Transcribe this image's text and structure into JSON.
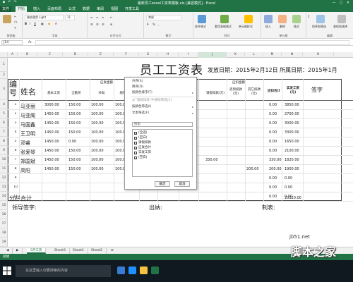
{
  "window": {
    "title": "最新员工excel工资表模板.xls [兼容模式] - Excel",
    "min_glyph": "—",
    "max_glyph": "□",
    "close_glyph": "✕"
  },
  "ribbon_tabs": [
    "文件",
    "开始",
    "插入",
    "页面布局",
    "公式",
    "数据",
    "审阅",
    "视图",
    "开发工具"
  ],
  "ribbon": {
    "font_name": "微软雅黑 Light",
    "font_size": "11",
    "number_format": "常规",
    "groups": [
      "剪贴板",
      "字体",
      "对齐方式",
      "数字",
      "样式",
      "单元格",
      "编辑"
    ],
    "buttons": [
      "条件格式",
      "套用表格格式",
      "单元格样式",
      "插入",
      "删除",
      "格式",
      "排序和筛选",
      "查找和选择"
    ]
  },
  "formula_bar": {
    "name_box": "J14",
    "fx": "fx",
    "value": ""
  },
  "columns": [
    "A",
    "B",
    "C",
    "D",
    "E",
    "F",
    "G",
    "H",
    "I",
    "J",
    "K",
    "L",
    "M",
    "N",
    "O"
  ],
  "selected_column": "J",
  "rows": [
    "1",
    "2",
    "3",
    "4",
    "5",
    "6",
    "7",
    "8",
    "9",
    "10",
    "11",
    "12",
    "13",
    "14",
    "15",
    "16",
    "17",
    "18",
    "19",
    "20",
    "21",
    "22",
    "23",
    "24",
    "25"
  ],
  "sheet": {
    "title": "员工工资表",
    "date_text": "发放日期：2015年2月12日  所属日期：2015年1月",
    "header": {
      "no": "编号",
      "name": "姓名",
      "earnings_group": "应发金额",
      "deductions_group": "应扣金额",
      "base_pay": "基本工资",
      "bonus": "全勤奖",
      "subsidy": "补助",
      "other": "绩效",
      "social": "请假扣款(元)",
      "late": "迟到扣款(元)",
      "other_deduct": "其它扣款(元)",
      "deduct_total": "应扣合计",
      "actual_pay": "实发工资(元)",
      "sign": "签字"
    },
    "employees": [
      {
        "no": "1",
        "name": "马亚丽",
        "base": "3000.00",
        "bonus": "150.00",
        "subsidy": "100.00",
        "other": "100.00",
        "leave": "",
        "late": "",
        "odeduct": "",
        "dtotal": "0.00",
        "actual": "3850.00"
      },
      {
        "no": "2",
        "name": "马亚阁",
        "base": "1450.00",
        "bonus": "150.00",
        "subsidy": "100.00",
        "other": "100.00",
        "leave": "",
        "late": "",
        "odeduct": "",
        "dtotal": "0.00",
        "actual": "2700.00"
      },
      {
        "no": "3",
        "name": "马国鑫",
        "base": "1450.00",
        "bonus": "150.00",
        "subsidy": "100.00",
        "other": "100.00",
        "leave": "",
        "late": "",
        "odeduct": "",
        "dtotal": "0.00",
        "actual": "3000.00"
      },
      {
        "no": "4",
        "name": "王卫明",
        "base": "1450.00",
        "bonus": "150.00",
        "subsidy": "100.00",
        "other": "100.00",
        "leave": "",
        "late": "",
        "odeduct": "",
        "dtotal": "0.00",
        "actual": "3300.00"
      },
      {
        "no": "5",
        "name": "邓睿",
        "base": "1450.00",
        "bonus": "0.00",
        "subsidy": "100.00",
        "other": "100.00",
        "leave": "",
        "late": "",
        "odeduct": "",
        "dtotal": "0.00",
        "actual": "1650.00"
      },
      {
        "no": "6",
        "name": "张爱琴",
        "base": "1450.00",
        "bonus": "150.00",
        "subsidy": "100.00",
        "other": "100.00",
        "leave": "",
        "late": "",
        "odeduct": "",
        "dtotal": "0.00",
        "actual": "2100.00"
      },
      {
        "no": "7",
        "name": "郑国斌",
        "base": "1450.00",
        "bonus": "150.00",
        "subsidy": "100.00",
        "other": "100.00",
        "leave": "330.00",
        "late": "",
        "odeduct": "",
        "dtotal": "330.00",
        "actual": "1820.00"
      },
      {
        "no": "8",
        "name": "高阳",
        "base": "1450.00",
        "bonus": "150.00",
        "subsidy": "100.00",
        "other": "100.00",
        "leave": "",
        "late": "",
        "odeduct": "200.00",
        "dtotal": "200.00",
        "actual": "1900.00"
      },
      {
        "no": "9",
        "name": "",
        "base": "",
        "bonus": "",
        "subsidy": "",
        "other": "",
        "leave": "",
        "late": "",
        "odeduct": "",
        "dtotal": "0.00",
        "actual": "0.00"
      },
      {
        "no": "10",
        "name": "",
        "base": "",
        "bonus": "",
        "subsidy": "",
        "other": "",
        "leave": "",
        "late": "",
        "odeduct": "",
        "dtotal": "0.00",
        "actual": "0.00"
      },
      {
        "no": "11",
        "name": "",
        "base": "",
        "bonus": "",
        "subsidy": "",
        "other": "",
        "leave": "",
        "late": "",
        "odeduct": "",
        "dtotal": "0.00",
        "actual": "0.00"
      }
    ],
    "total_label": "分栏合计",
    "total_value": "20320.00",
    "sign_leader": "领导签字:",
    "sign_cashier": "出纳:",
    "sign_maker": "制表:"
  },
  "filter_menu": {
    "items": [
      "升序(S)",
      "降序(O)",
      "按颜色排序(T)",
      "从“请假扣款”中清除筛选(C)",
      "按颜色筛选(I)",
      "文本筛选(F)"
    ],
    "search_placeholder": "搜索",
    "list": [
      "(全选)",
      "(空白)",
      "请假扣款",
      "应发合计",
      "实发工资",
      "(空白)"
    ],
    "ok": "确定",
    "cancel": "取消"
  },
  "sheet_tabs": [
    "5月工资",
    "Sheet3",
    "Sheet1",
    "Sheet2"
  ],
  "add_sheet": "⊕",
  "status": "就绪",
  "taskbar": {
    "search": "在这里输入你要搜索的内容"
  },
  "watermark": {
    "line1": "jb51.net",
    "line2": "脚本之家"
  }
}
